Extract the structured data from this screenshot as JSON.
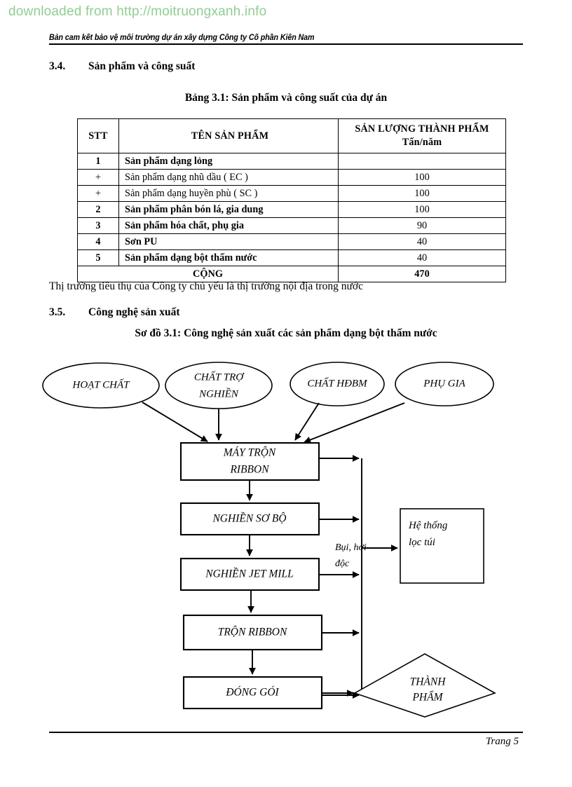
{
  "watermark": "downloaded from http://moitruongxanh.info",
  "header": {
    "running_title": "Bản cam kết bảo vệ môi trường dự án xây dựng Công ty Cổ phần Kiên Nam"
  },
  "sections": {
    "s34": {
      "number": "3.4.",
      "title": "Sản phẩm và công suất"
    },
    "s35": {
      "number": "3.5.",
      "title": "Công nghệ sản xuất"
    }
  },
  "table": {
    "caption": "Bảng 3.1: Sản phẩm và công suất của dự án",
    "columns": [
      "STT",
      "TÊN SẢN PHẨM",
      "SẢN LƯỢNG THÀNH PHẨM"
    ],
    "qty_unit": "Tấn/năm",
    "rows": [
      {
        "stt": "1",
        "name": "Sản phẩm dạng lỏng",
        "qty": "",
        "bold": true
      },
      {
        "stt": "+",
        "name": "Sản phẩm dạng nhũ dầu ( EC )",
        "qty": "100",
        "bold": false
      },
      {
        "stt": "+",
        "name": "Sản phẩm dạng huyền phù ( SC )",
        "qty": "100",
        "bold": false
      },
      {
        "stt": "2",
        "name": "Sản phẩm phân bón lá, gia dung",
        "qty": "100",
        "bold": true
      },
      {
        "stt": "3",
        "name": "Sản phẩm hóa chất, phụ gia",
        "qty": "90",
        "bold": true
      },
      {
        "stt": "4",
        "name": "Sơn PU",
        "qty": "40",
        "bold": true
      },
      {
        "stt": "5",
        "name": "Sản phẩm dạng bột thấm nước",
        "qty": "40",
        "bold": true
      }
    ],
    "total_label": "CỘNG",
    "total_value": "470"
  },
  "paragraphs": {
    "market": "Thị trường tiêu thụ của Công ty chủ yếu là thị trường nội địa trong nước"
  },
  "diagram": {
    "caption": "Sơ đồ 3.1: Công nghệ sản xuất các sản phẩm dạng bột thấm nước",
    "inputs": [
      {
        "id": "hoat-chat",
        "label": "HOẠT CHẤT"
      },
      {
        "id": "chat-tro-nghien",
        "label_line1": "CHẤT TRỢ",
        "label_line2": "NGHIỀN"
      },
      {
        "id": "chat-hdbm",
        "label": "CHẤT HĐBM"
      },
      {
        "id": "phu-gia",
        "label": "PHỤ GIA"
      }
    ],
    "process_steps": [
      {
        "id": "may-tron-ribbon",
        "label_line1": "MÁY TRỘN",
        "label_line2": "RIBBON"
      },
      {
        "id": "nghien-so-bo",
        "label": "NGHIỀN SƠ BỘ"
      },
      {
        "id": "nghien-jet-mill",
        "label": "NGHIỀN JET MILL"
      },
      {
        "id": "tron-ribbon",
        "label": "TRỘN RIBBON"
      },
      {
        "id": "dong-goi",
        "label": "ĐÓNG GÓI"
      }
    ],
    "emission_label_line1": "Bụi, hơi",
    "emission_label_line2": "độc",
    "filter": {
      "label_line1": "Hệ thống",
      "label_line2": "lọc túi"
    },
    "output": {
      "label_line1": "THÀNH",
      "label_line2": "PHẨM"
    }
  },
  "footer": {
    "page": "Trang 5"
  },
  "colors": {
    "watermark": "#8fce92",
    "ink": "#000000",
    "page": "#ffffff"
  }
}
